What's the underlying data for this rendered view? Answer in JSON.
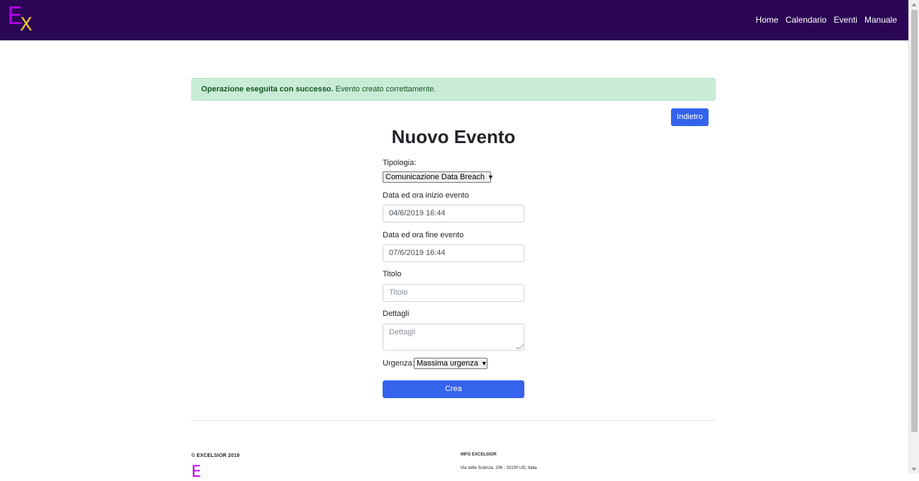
{
  "navbar": {
    "logo_letter_e": "E",
    "logo_letter_x": "X",
    "links": [
      "Home",
      "Calendario",
      "Eventi",
      "Manuale"
    ],
    "background_color": "#2a0655"
  },
  "alert": {
    "strong": "Operazione eseguita con successo.",
    "message": "Evento creato correttamente.",
    "color": "#c9ecd6"
  },
  "back_button": "Indietro",
  "page_title": "Nuovo Evento",
  "form": {
    "tipologia_label": "Tipologia:",
    "tipologia_value": "Comunicazione Data Breach",
    "start_label": "Data ed ora inizio evento",
    "start_value": "04/6/2019 16:44",
    "end_label": "Data ed ora fine evento",
    "end_value": "07/6/2019 16:44",
    "title_label": "Titolo",
    "title_placeholder": "Titolo",
    "details_label": "Dettagli",
    "details_placeholder": "Dettagli",
    "urgency_label": "Urgenza:",
    "urgency_value": "Massima urgenza",
    "submit_label": "Crea"
  },
  "footer": {
    "copyright": "© EXCELSIOR 2019",
    "logo_letter": "E",
    "info_title": "INFO EXCELSIOR",
    "info_address": "Via delle Scienze, 206 - 33100 UD, Italia"
  },
  "accent_color": "#3563ec"
}
